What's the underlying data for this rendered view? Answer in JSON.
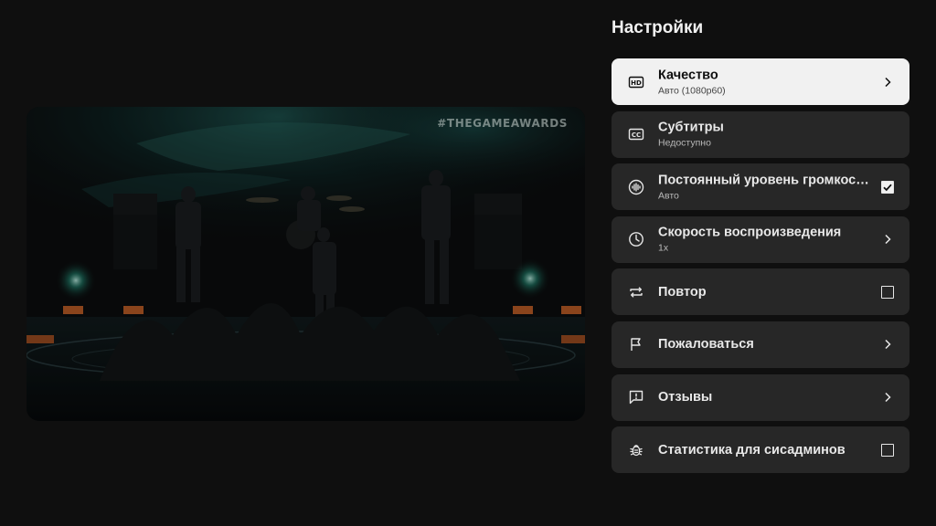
{
  "video": {
    "watermark": "#THEGAMEAWARDS"
  },
  "panel": {
    "title": "Настройки"
  },
  "menu": [
    {
      "id": "quality",
      "icon": "hd-icon",
      "label": "Качество",
      "sub": "Авто (1080p60)",
      "trailing": "chevron",
      "selected": true
    },
    {
      "id": "subtitles",
      "icon": "cc-icon",
      "label": "Субтитры",
      "sub": "Недоступно",
      "trailing": "none",
      "selected": false
    },
    {
      "id": "stable-volume",
      "icon": "audio-wave-icon",
      "label": "Постоянный уровень громкости",
      "sub": "Авто",
      "trailing": "checkbox",
      "checked": true,
      "selected": false
    },
    {
      "id": "playback-speed",
      "icon": "speed-icon",
      "label": "Скорость воспроизведения",
      "sub": "1x",
      "trailing": "chevron",
      "selected": false
    },
    {
      "id": "repeat",
      "icon": "repeat-icon",
      "label": "Повтор",
      "sub": "",
      "trailing": "checkbox",
      "checked": false,
      "selected": false
    },
    {
      "id": "report",
      "icon": "flag-icon",
      "label": "Пожаловаться",
      "sub": "",
      "trailing": "chevron",
      "selected": false
    },
    {
      "id": "feedback",
      "icon": "feedback-icon",
      "label": "Отзывы",
      "sub": "",
      "trailing": "chevron",
      "selected": false
    },
    {
      "id": "stats-for-nerds",
      "icon": "bug-icon",
      "label": "Статистика для сисадминов",
      "sub": "",
      "trailing": "checkbox",
      "checked": false,
      "selected": false
    }
  ]
}
